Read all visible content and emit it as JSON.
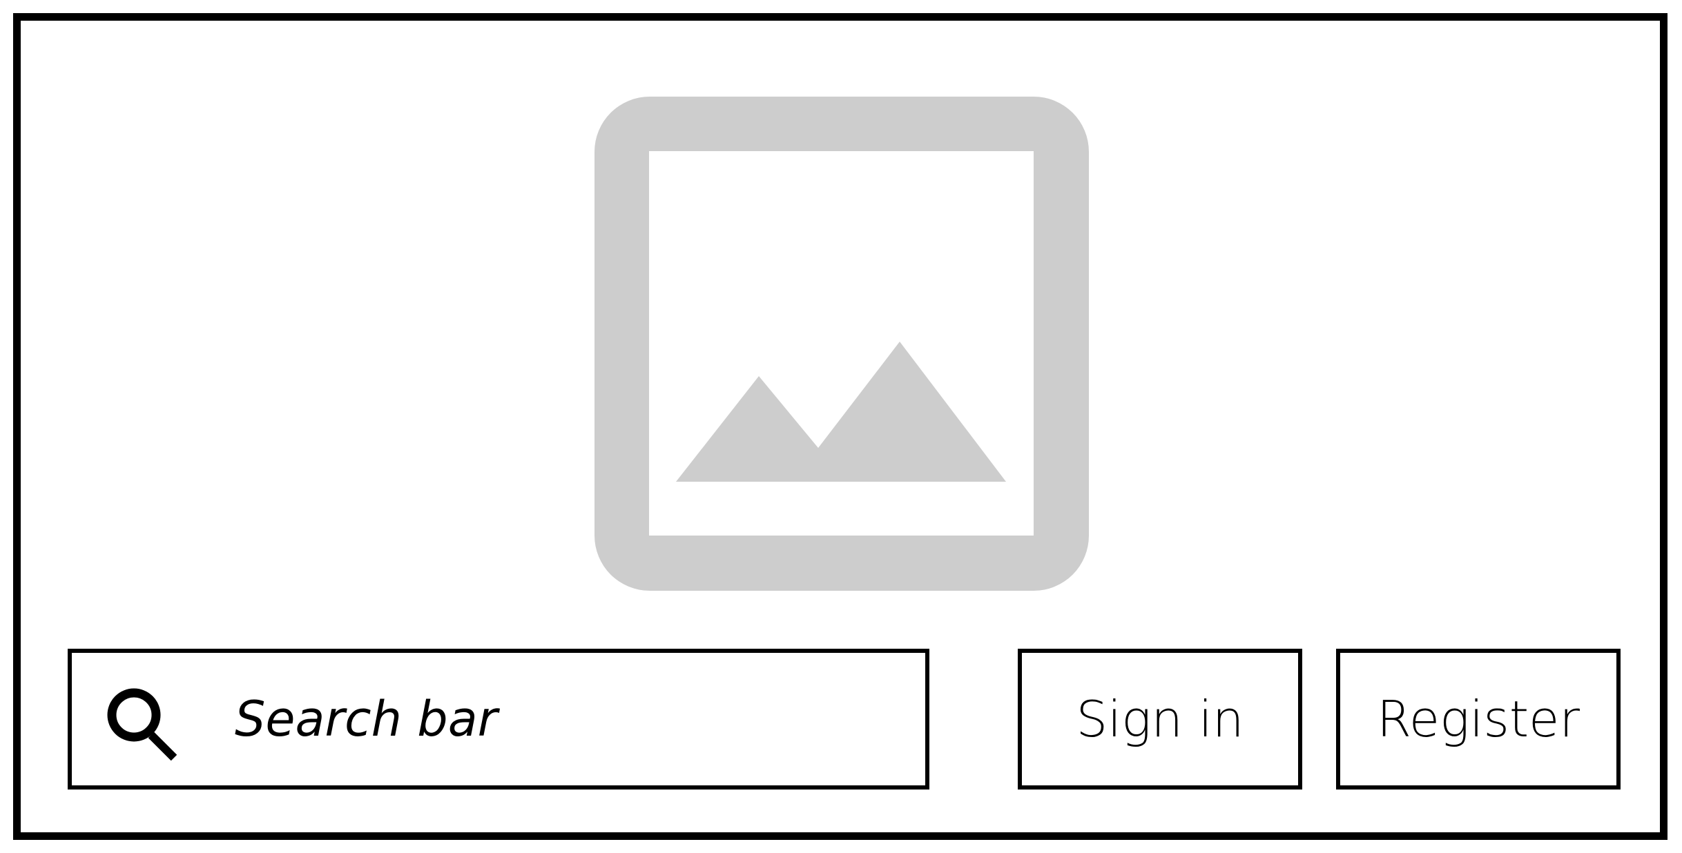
{
  "image_placeholder": {
    "icon": "image-icon",
    "color": "#cdcdcd"
  },
  "search": {
    "icon": "search-icon",
    "placeholder": "Search bar",
    "value": ""
  },
  "actions": {
    "sign_in_label": "Sign in",
    "register_label": "Register"
  },
  "colors": {
    "border": "#000000",
    "background": "#ffffff",
    "placeholder_gray": "#cdcdcd"
  }
}
